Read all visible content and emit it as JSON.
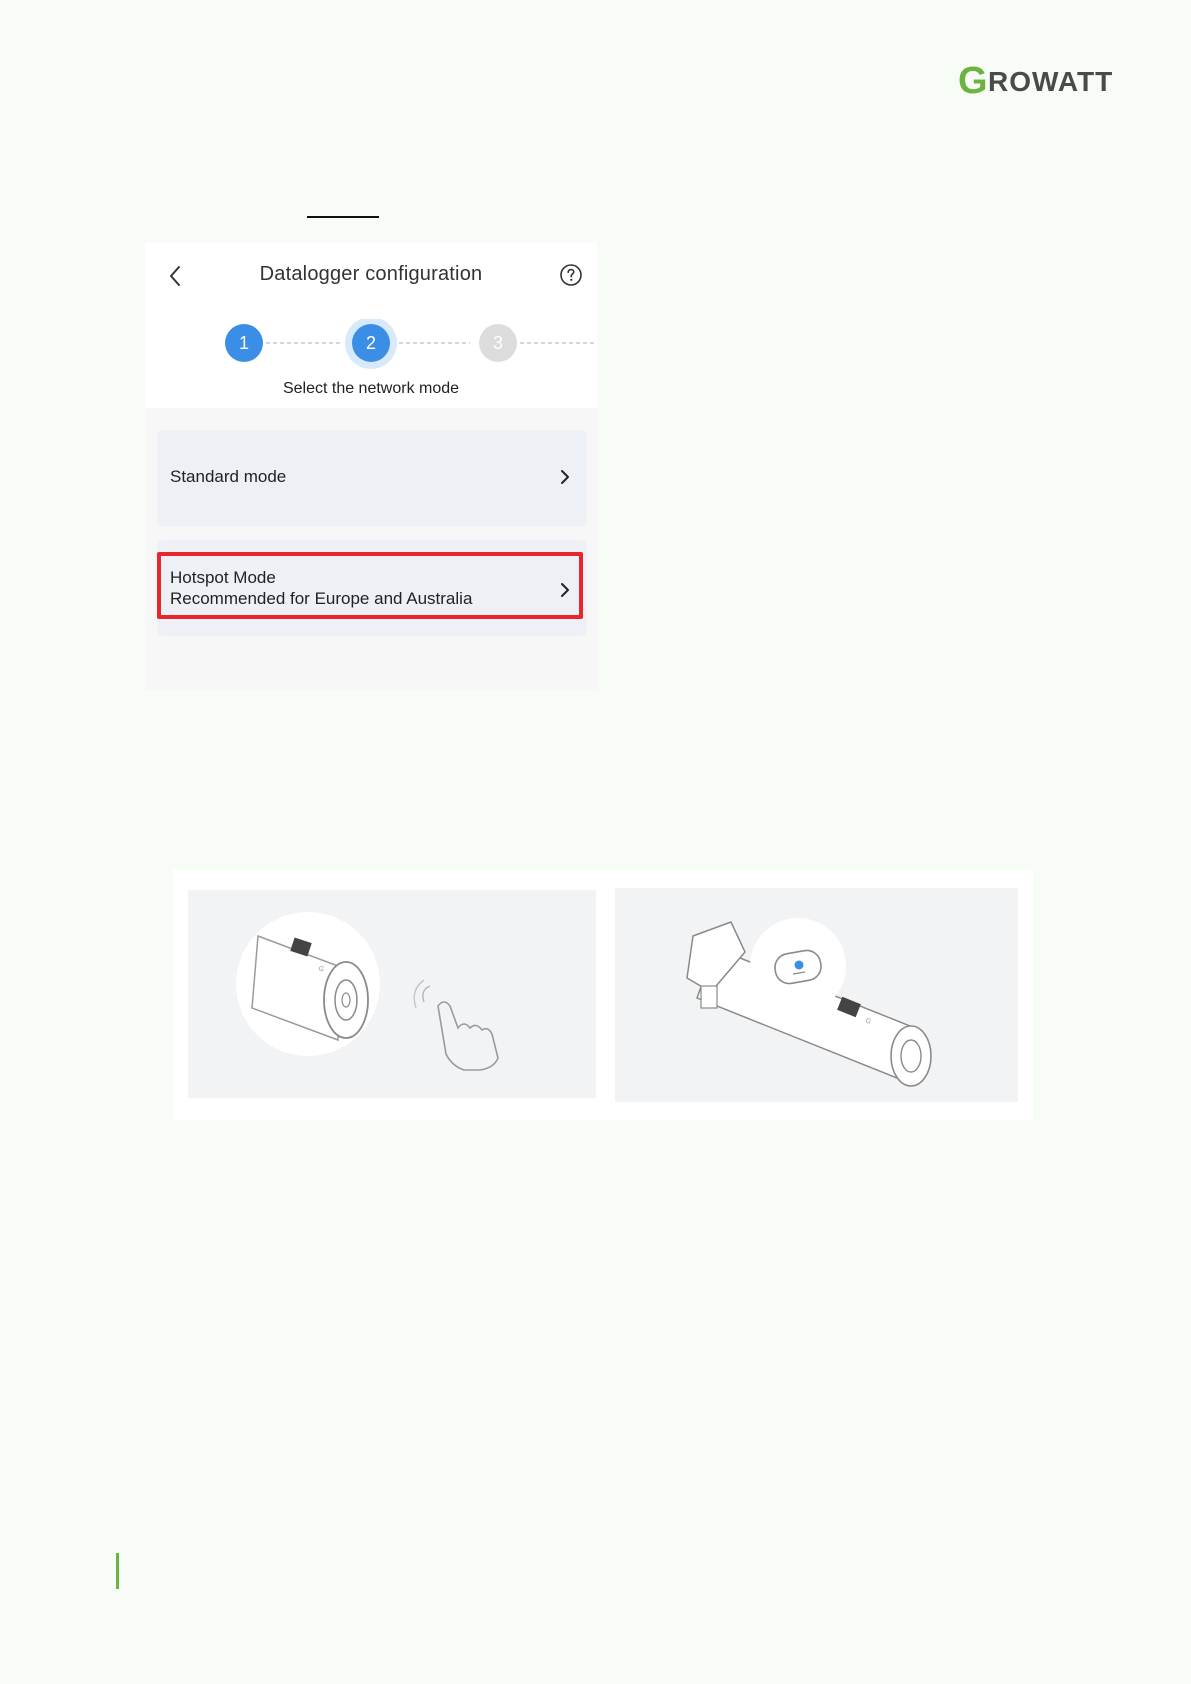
{
  "brand": {
    "logo_text": "GROWATT",
    "logo_color_g": "#6db33f",
    "logo_color_text": "#4a4a4a"
  },
  "app": {
    "title": "Datalogger configuration",
    "steps": [
      "1",
      "2",
      "3"
    ],
    "active_step": 2,
    "step_label": "Select the network mode",
    "colors": {
      "active": "#3a8ee6",
      "inactive": "#dcdcdc",
      "highlight": "#e8262b"
    }
  },
  "modes": {
    "standard_label": "Standard mode",
    "hotspot_label": "Hotspot Mode",
    "hotspot_sub": "Recommended for Europe and Australia"
  },
  "illustrations": {
    "left": "datalogger-press-button",
    "right": "datalogger-blue-indicator"
  }
}
